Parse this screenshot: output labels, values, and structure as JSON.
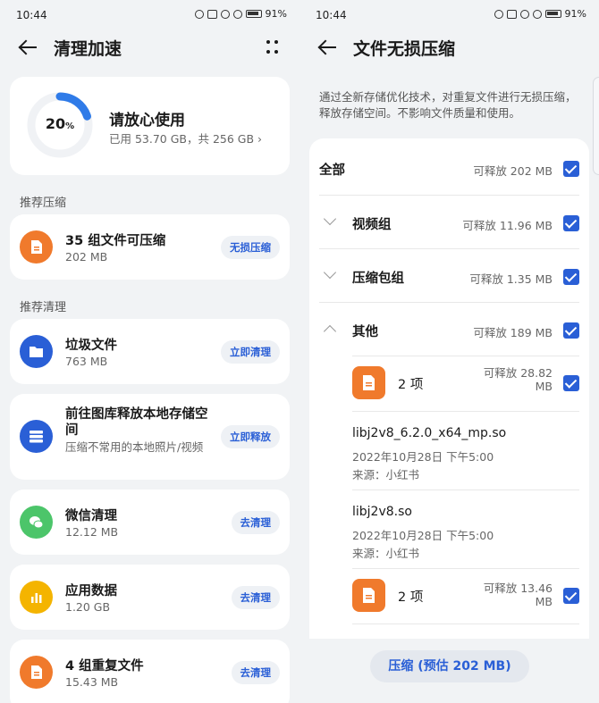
{
  "status": {
    "time": "10:44",
    "battery": "91%"
  },
  "left": {
    "title": "清理加速",
    "storage": {
      "percent": "20",
      "percent_unit": "%",
      "percent_value": 20,
      "title": "请放心使用",
      "detail": "已用 53.70 GB，共 256 GB"
    },
    "section_compress": "推荐压缩",
    "compress_item": {
      "title": "35 组文件可压缩",
      "size": "202 MB",
      "action": "无损压缩"
    },
    "section_clean": "推荐清理",
    "items": [
      {
        "title": "垃圾文件",
        "size": "763 MB",
        "action": "立即清理"
      },
      {
        "title": "前往图库释放本地存储空间",
        "size": "压缩不常用的本地照片/视频",
        "action": "立即释放"
      },
      {
        "title": "微信清理",
        "size": "12.12 MB",
        "action": "去清理"
      },
      {
        "title": "应用数据",
        "size": "1.20 GB",
        "action": "去清理"
      },
      {
        "title": "4 组重复文件",
        "size": "15.43 MB",
        "action": "去清理"
      }
    ]
  },
  "right": {
    "title": "文件无损压缩",
    "intro": "通过全新存储优化技术，对重复文件进行无损压缩，释放存储空间。不影响文件质量和使用。",
    "all": {
      "label": "全部",
      "amount": "可释放 202 MB"
    },
    "groups": [
      {
        "label": "视频组",
        "amount": "可释放 11.96 MB"
      },
      {
        "label": "压缩包组",
        "amount": "可释放 1.35 MB"
      },
      {
        "label": "其他",
        "amount": "可释放 189 MB"
      }
    ],
    "sub1": {
      "count": "2 项",
      "amount_l1": "可释放 28.82",
      "amount_l2": "MB"
    },
    "files": [
      {
        "name": "libj2v8_6.2.0_x64_mp.so",
        "date": "2022年10月28日 下午5:00",
        "source": "来源：小红书"
      },
      {
        "name": "libj2v8.so",
        "date": "2022年10月28日 下午5:00",
        "source": "来源：小红书"
      }
    ],
    "sub2": {
      "count": "2 项",
      "amount_l1": "可释放 13.46",
      "amount_l2": "MB"
    },
    "button": "压缩 (预估 202 MB)"
  },
  "colors": {
    "accent": "#2a5fd6",
    "orange": "#f07a2c",
    "blue_icon": "#2a5fd6",
    "green": "#4cc56a",
    "yellow": "#f4b400"
  }
}
